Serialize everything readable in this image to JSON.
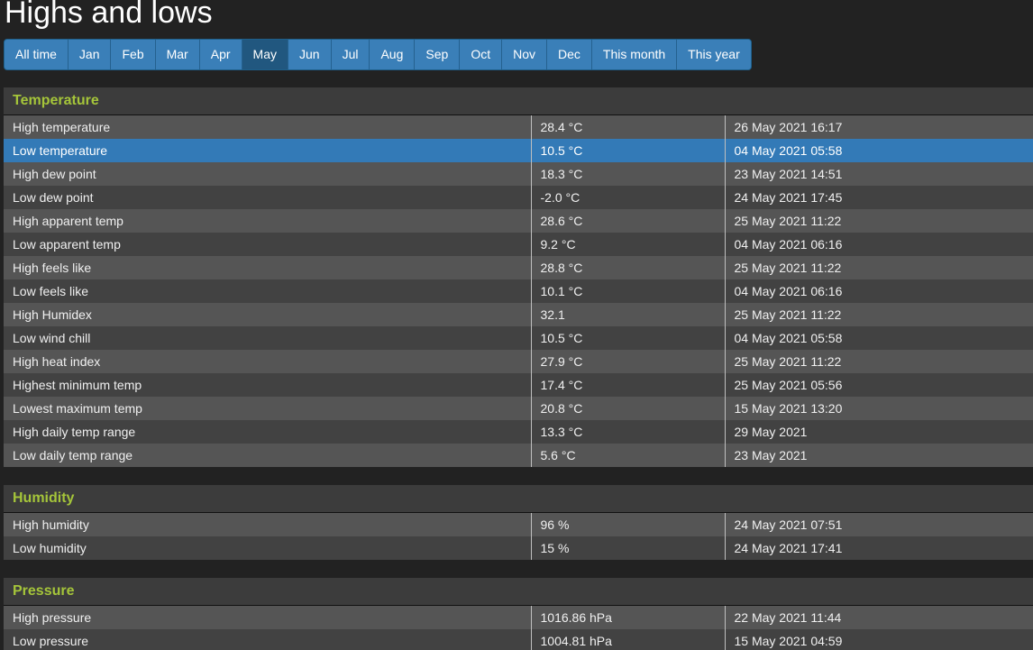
{
  "page": {
    "title": "Highs and lows"
  },
  "tabs": [
    {
      "label": "All time",
      "active": false
    },
    {
      "label": "Jan",
      "active": false
    },
    {
      "label": "Feb",
      "active": false
    },
    {
      "label": "Mar",
      "active": false
    },
    {
      "label": "Apr",
      "active": false
    },
    {
      "label": "May",
      "active": true
    },
    {
      "label": "Jun",
      "active": false
    },
    {
      "label": "Jul",
      "active": false
    },
    {
      "label": "Aug",
      "active": false
    },
    {
      "label": "Sep",
      "active": false
    },
    {
      "label": "Oct",
      "active": false
    },
    {
      "label": "Nov",
      "active": false
    },
    {
      "label": "Dec",
      "active": false
    },
    {
      "label": "This month",
      "active": false
    },
    {
      "label": "This year",
      "active": false
    }
  ],
  "sections": {
    "temperature": {
      "title": "Temperature",
      "rows": [
        {
          "label": "High temperature",
          "value": "28.4 °C",
          "time": "26 May 2021 16:17"
        },
        {
          "label": "Low temperature",
          "value": "10.5 °C",
          "time": "04 May 2021 05:58",
          "selected": true
        },
        {
          "label": "High dew point",
          "value": "18.3 °C",
          "time": "23 May 2021 14:51"
        },
        {
          "label": "Low dew point",
          "value": "-2.0 °C",
          "time": "24 May 2021 17:45"
        },
        {
          "label": "High apparent temp",
          "value": "28.6 °C",
          "time": "25 May 2021 11:22"
        },
        {
          "label": "Low apparent temp",
          "value": "9.2 °C",
          "time": "04 May 2021 06:16"
        },
        {
          "label": "High feels like",
          "value": "28.8 °C",
          "time": "25 May 2021 11:22"
        },
        {
          "label": "Low feels like",
          "value": "10.1 °C",
          "time": "04 May 2021 06:16"
        },
        {
          "label": "High Humidex",
          "value": "32.1",
          "time": "25 May 2021 11:22"
        },
        {
          "label": "Low wind chill",
          "value": "10.5 °C",
          "time": "04 May 2021 05:58"
        },
        {
          "label": "High heat index",
          "value": "27.9 °C",
          "time": "25 May 2021 11:22"
        },
        {
          "label": "Highest minimum temp",
          "value": "17.4 °C",
          "time": "25 May 2021 05:56"
        },
        {
          "label": "Lowest maximum temp",
          "value": "20.8 °C",
          "time": "15 May 2021 13:20"
        },
        {
          "label": "High daily temp range",
          "value": "13.3 °C",
          "time": "29 May 2021"
        },
        {
          "label": "Low daily temp range",
          "value": "5.6 °C",
          "time": "23 May 2021"
        }
      ]
    },
    "humidity": {
      "title": "Humidity",
      "rows": [
        {
          "label": "High humidity",
          "value": "96 %",
          "time": "24 May 2021 07:51"
        },
        {
          "label": "Low humidity",
          "value": "15 %",
          "time": "24 May 2021 17:41"
        }
      ]
    },
    "pressure": {
      "title": "Pressure",
      "rows": [
        {
          "label": "High pressure",
          "value": "1016.86 hPa",
          "time": "22 May 2021 11:44"
        },
        {
          "label": "Low pressure",
          "value": "1004.81 hPa",
          "time": "15 May 2021 04:59"
        }
      ]
    }
  },
  "colors": {
    "accent": "#337ab7",
    "section_title": "#a5c53a",
    "background": "#222222"
  }
}
